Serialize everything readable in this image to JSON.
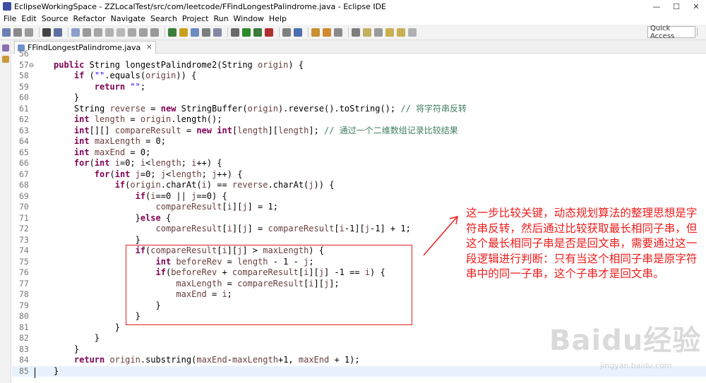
{
  "window": {
    "title": "EclipseWorkingSpace - ZZLocalTest/src/com/leetcode/FFindLongestPalindrome.java - Eclipse IDE",
    "controls": [
      "—",
      "☐",
      "✕"
    ]
  },
  "menu": [
    "File",
    "Edit",
    "Source",
    "Refactor",
    "Navigate",
    "Search",
    "Project",
    "Run",
    "Window",
    "Help"
  ],
  "toolbar": {
    "quick_access_label": "Quick Access"
  },
  "editor": {
    "tab_label": "FFindLongestPalindrome.java",
    "tab_close": "✕",
    "lines": [
      {
        "num": "56",
        "html": ""
      },
      {
        "num": "57⊖",
        "html": "<span class=\"kw\">public</span> String longestPalindrome2(String <span class=\"var\">origin</span>) {"
      },
      {
        "num": "58",
        "html": "    <span class=\"kw\">if</span> (<span class=\"str\">\"\"</span>.equals(<span class=\"var\">origin</span>)) {"
      },
      {
        "num": "59",
        "html": "        <span class=\"kw\">return</span> <span class=\"str\">\"\"</span>;"
      },
      {
        "num": "60",
        "html": "    }"
      },
      {
        "num": "61",
        "html": "    String <span class=\"var\">reverse</span> = <span class=\"kw\">new</span> StringBuffer(<span class=\"var\">origin</span>).reverse().toString(); <span class=\"cm\">// 将字符串反转</span>"
      },
      {
        "num": "62",
        "html": "    <span class=\"kw\">int</span> <span class=\"var\">length</span> = <span class=\"var\">origin</span>.length();"
      },
      {
        "num": "63",
        "html": "    <span class=\"kw\">int</span>[][] <span class=\"var\">compareResult</span> = <span class=\"kw\">new</span> <span class=\"kw\">int</span>[<span class=\"var\">length</span>][<span class=\"var\">length</span>]; <span class=\"cm\">// 通过一个二维数组记录比较结果</span>"
      },
      {
        "num": "64",
        "html": "    <span class=\"kw\">int</span> <span class=\"var\">maxLength</span> = 0;"
      },
      {
        "num": "65",
        "html": "    <span class=\"kw\">int</span> <span class=\"var\">maxEnd</span> = 0;"
      },
      {
        "num": "66",
        "html": "    <span class=\"kw\">for</span>(<span class=\"kw\">int</span> <span class=\"var\">i</span>=0; <span class=\"var\">i</span>&lt;<span class=\"var\">length</span>; <span class=\"var\">i</span>++) {"
      },
      {
        "num": "67",
        "html": "        <span class=\"kw\">for</span>(<span class=\"kw\">int</span> <span class=\"var\">j</span>=0; <span class=\"var\">j</span>&lt;<span class=\"var\">length</span>; <span class=\"var\">j</span>++) {"
      },
      {
        "num": "68",
        "html": "            <span class=\"kw\">if</span>(<span class=\"var\">origin</span>.charAt(<span class=\"var\">i</span>) == <span class=\"var\">reverse</span>.charAt(<span class=\"var\">j</span>)) {"
      },
      {
        "num": "69",
        "html": "                <span class=\"kw\">if</span>(<span class=\"var\">i</span>==0 || <span class=\"var\">j</span>==0) {"
      },
      {
        "num": "70",
        "html": "                    <span class=\"var\">compareResult</span>[<span class=\"var\">i</span>][<span class=\"var\">j</span>] = 1;"
      },
      {
        "num": "71",
        "html": "                }<span class=\"kw\">else</span> {"
      },
      {
        "num": "72",
        "html": "                    <span class=\"var\">compareResult</span>[<span class=\"var\">i</span>][<span class=\"var\">j</span>] = <span class=\"var\">compareResult</span>[<span class=\"var\">i</span>-1][<span class=\"var\">j</span>-1] + 1;"
      },
      {
        "num": "73",
        "html": "                }"
      },
      {
        "num": "74",
        "html": "                <span class=\"kw\">if</span>(<span class=\"var\">compareResult</span>[<span class=\"var\">i</span>][<span class=\"var\">j</span>] &gt; <span class=\"var\">maxLength</span>) {"
      },
      {
        "num": "75",
        "html": "                    <span class=\"kw\">int</span> <span class=\"var\">beforeRev</span> = <span class=\"var\">length</span> - 1 - <span class=\"var\">j</span>;"
      },
      {
        "num": "76",
        "html": "                    <span class=\"kw\">if</span>(<span class=\"var\">beforeRev</span> + <span class=\"var\">compareResult</span>[<span class=\"var\">i</span>][<span class=\"var\">j</span>] -1 == <span class=\"var\">i</span>) {"
      },
      {
        "num": "77",
        "html": "                        <span class=\"var\">maxLength</span> = <span class=\"var\">compareResult</span>[<span class=\"var\">i</span>][<span class=\"var\">j</span>];"
      },
      {
        "num": "78",
        "html": "                        <span class=\"var\">maxEnd</span> = <span class=\"var\">i</span>;"
      },
      {
        "num": "79",
        "html": "                    }"
      },
      {
        "num": "80",
        "html": "                }"
      },
      {
        "num": "81",
        "html": "            }"
      },
      {
        "num": "82",
        "html": "        }"
      },
      {
        "num": "83",
        "html": "    }"
      },
      {
        "num": "84",
        "html": "    <span class=\"kw\">return</span> <span class=\"var\">origin</span>.substring(<span class=\"var\">maxEnd</span>-<span class=\"var\">maxLength</span>+1, <span class=\"var\">maxEnd</span> + 1);"
      },
      {
        "num": "85",
        "html": "}"
      }
    ]
  },
  "annotation": {
    "text": "这一步比较关键，动态规划算法的整理思想是字符串反转，然后通过比较获取最长相同子串，但这个最长相同子串是否是回文串，需要通过这一段逻辑进行判断：只有当这个相同子串是原字符串中的同一子串，这个子串才是回文串。",
    "color": "#ee1b1b"
  },
  "watermark": {
    "text": "Baidu经验",
    "sub": "jingyan.baidu.com"
  }
}
